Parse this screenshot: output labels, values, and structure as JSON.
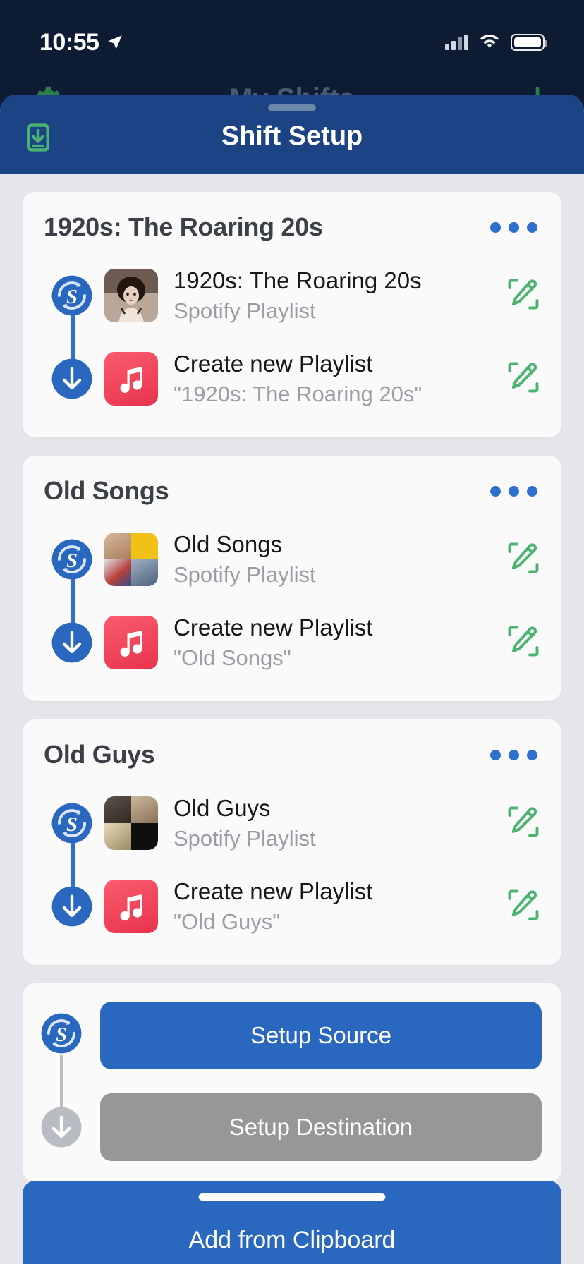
{
  "status_bar": {
    "time": "10:55",
    "location_icon": "location-arrow-icon",
    "signal_icon": "cellular-signal-icon",
    "wifi_icon": "wifi-icon",
    "battery_icon": "battery-icon"
  },
  "background_nav": {
    "title": "My Shifts",
    "left_icon": "gear-icon",
    "right_icon": "plus-icon"
  },
  "sheet": {
    "title": "Shift Setup",
    "left_icon": "import-download-icon",
    "grabber": "drag-handle"
  },
  "colors": {
    "header_blue": "#1c4384",
    "accent_blue": "#2a68c0",
    "dot_blue": "#2f6fd0",
    "edit_green": "#4cb472",
    "muted_gray": "#979797",
    "apple_red": "#e8334d",
    "body_bg": "#e4e6eb",
    "card_bg": "#fafafa"
  },
  "cards": [
    {
      "title": "1920s: The Roaring 20s",
      "menu_icon": "more-options-icon",
      "rows": [
        {
          "rail_icon": "shift-source-icon",
          "thumb_kind": "photo-portrait",
          "title": "1920s: The Roaring 20s",
          "subtitle": "Spotify Playlist",
          "action_icon": "edit-pencil-icon"
        },
        {
          "rail_icon": "arrow-down-icon",
          "thumb_kind": "apple-music",
          "title": "Create new Playlist",
          "subtitle": "\"1920s: The Roaring 20s\"",
          "action_icon": "edit-pencil-icon"
        }
      ]
    },
    {
      "title": "Old Songs",
      "menu_icon": "more-options-icon",
      "rows": [
        {
          "rail_icon": "shift-source-icon",
          "thumb_kind": "collage",
          "title": "Old Songs",
          "subtitle": "Spotify Playlist",
          "action_icon": "edit-pencil-icon"
        },
        {
          "rail_icon": "arrow-down-icon",
          "thumb_kind": "apple-music",
          "title": "Create new Playlist",
          "subtitle": "\"Old Songs\"",
          "action_icon": "edit-pencil-icon"
        }
      ]
    },
    {
      "title": "Old Guys",
      "menu_icon": "more-options-icon",
      "rows": [
        {
          "rail_icon": "shift-source-icon",
          "thumb_kind": "collage-dark",
          "title": "Old Guys",
          "subtitle": "Spotify Playlist",
          "action_icon": "edit-pencil-icon"
        },
        {
          "rail_icon": "arrow-down-icon",
          "thumb_kind": "apple-music",
          "title": "Create new Playlist",
          "subtitle": "\"Old Guys\"",
          "action_icon": "edit-pencil-icon"
        }
      ]
    }
  ],
  "setup_card": {
    "source_button": "Setup Source",
    "destination_button": "Setup Destination",
    "source_icon": "shift-source-icon",
    "destination_icon": "arrow-down-icon"
  },
  "clipboard_button": {
    "label": "Add from Clipboard"
  }
}
